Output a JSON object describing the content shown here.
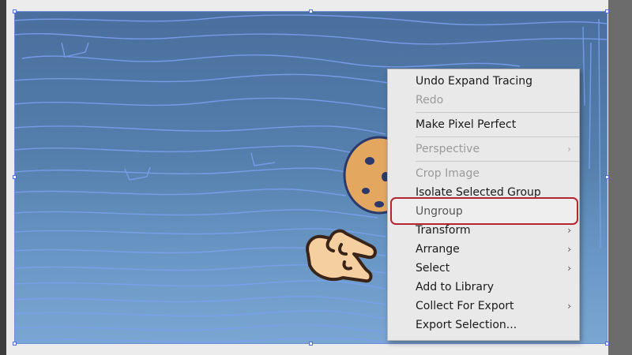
{
  "context_menu": {
    "groups": [
      [
        {
          "label": "Undo Expand Tracing",
          "enabled": true,
          "submenu": false
        },
        {
          "label": "Redo",
          "enabled": false,
          "submenu": false
        }
      ],
      [
        {
          "label": "Make Pixel Perfect",
          "enabled": true,
          "submenu": false
        }
      ],
      [
        {
          "label": "Perspective",
          "enabled": false,
          "submenu": true
        }
      ],
      [
        {
          "label": "Crop Image",
          "enabled": false,
          "submenu": false
        },
        {
          "label": "Isolate Selected Group",
          "enabled": true,
          "submenu": false
        },
        {
          "label": "Ungroup",
          "enabled": true,
          "submenu": false,
          "highlighted": true
        },
        {
          "label": "Transform",
          "enabled": true,
          "submenu": true
        },
        {
          "label": "Arrange",
          "enabled": true,
          "submenu": true
        },
        {
          "label": "Select",
          "enabled": true,
          "submenu": true
        },
        {
          "label": "Add to Library",
          "enabled": true,
          "submenu": false
        },
        {
          "label": "Collect For Export",
          "enabled": true,
          "submenu": true
        },
        {
          "label": "Export Selection...",
          "enabled": true,
          "submenu": false
        }
      ]
    ]
  },
  "icons": {
    "submenu_arrow": "chevron-right-icon",
    "pointer": "pointing-hand-icon"
  },
  "colors": {
    "highlight_border": "#b3262f",
    "canvas_top": "#4a6e9d",
    "canvas_bottom": "#7aa6d2",
    "trace_lines": "#7b9ff0",
    "selection": "#6b8fd6"
  }
}
